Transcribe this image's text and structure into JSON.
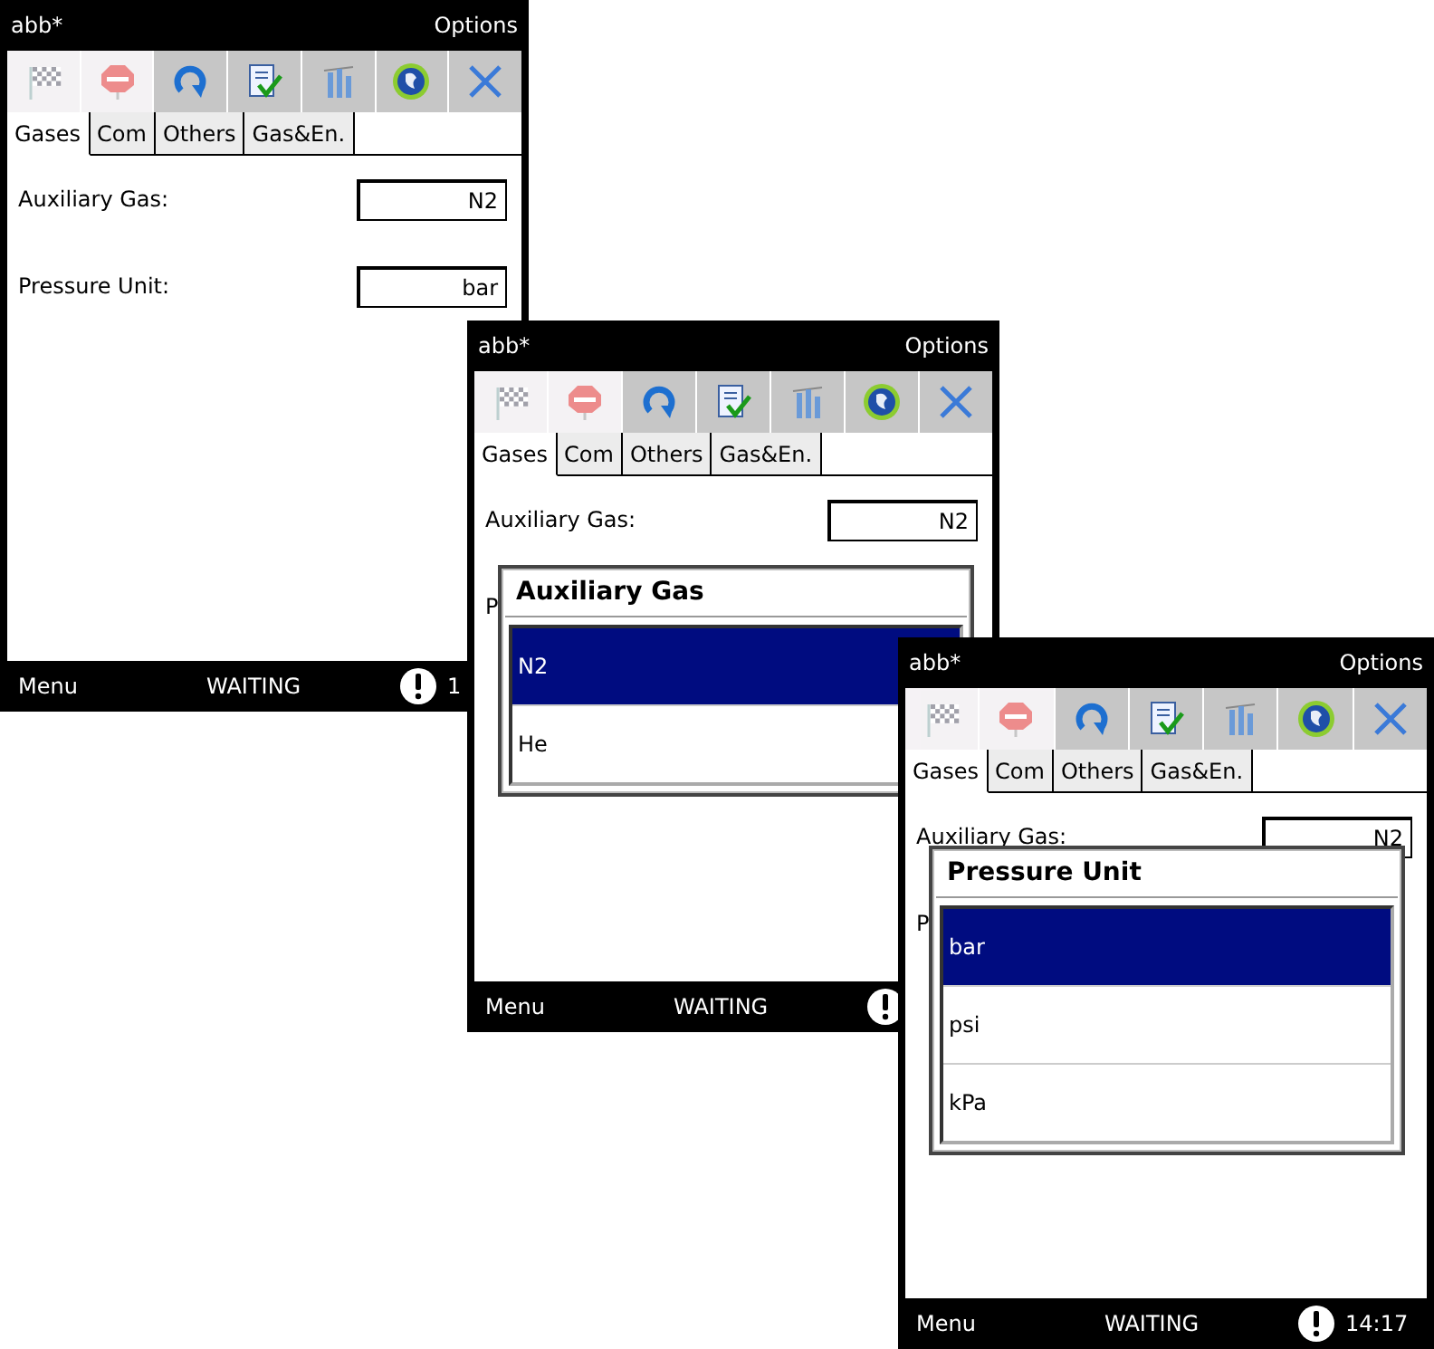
{
  "screens": [
    {
      "title": "abb*",
      "menu_right": "Options",
      "toolbar": [
        {
          "disabled": true
        },
        {
          "disabled": true
        },
        {
          "disabled": false
        },
        {
          "disabled": false
        },
        {
          "disabled": false
        },
        {
          "disabled": false
        },
        {
          "disabled": false
        }
      ],
      "tabs": [
        {
          "label": "Gases",
          "selected": true
        },
        {
          "label": "Com",
          "selected": false
        },
        {
          "label": "Others",
          "selected": false
        },
        {
          "label": "Gas&En.",
          "selected": false
        }
      ],
      "fields": [
        {
          "label": "Auxiliary Gas:",
          "value": "N2"
        },
        {
          "label": "Pressure Unit:",
          "value": "bar"
        }
      ],
      "status": {
        "left": "Menu",
        "center": "WAITING",
        "clock": "1"
      }
    },
    {
      "title": "abb*",
      "menu_right": "Options",
      "toolbar": [
        {
          "disabled": true
        },
        {
          "disabled": true
        },
        {
          "disabled": false
        },
        {
          "disabled": false
        },
        {
          "disabled": false
        },
        {
          "disabled": false
        },
        {
          "disabled": false
        }
      ],
      "tabs": [
        {
          "label": "Gases",
          "selected": true
        },
        {
          "label": "Com",
          "selected": false
        },
        {
          "label": "Others",
          "selected": false
        },
        {
          "label": "Gas&En.",
          "selected": false
        }
      ],
      "fields": [
        {
          "label": "Auxiliary Gas:",
          "value": "N2"
        },
        {
          "label": "P"
        }
      ],
      "popup": {
        "title": "Auxiliary Gas",
        "options": [
          {
            "label": "N2",
            "selected": true
          },
          {
            "label": "He",
            "selected": false
          }
        ]
      },
      "status": {
        "left": "Menu",
        "center": "WAITING"
      }
    },
    {
      "title": "abb*",
      "menu_right": "Options",
      "toolbar": [
        {
          "disabled": true
        },
        {
          "disabled": true
        },
        {
          "disabled": false
        },
        {
          "disabled": false
        },
        {
          "disabled": false
        },
        {
          "disabled": false
        },
        {
          "disabled": false
        }
      ],
      "tabs": [
        {
          "label": "Gases",
          "selected": true
        },
        {
          "label": "Com",
          "selected": false
        },
        {
          "label": "Others",
          "selected": false
        },
        {
          "label": "Gas&En.",
          "selected": false
        }
      ],
      "fields": [
        {
          "label": "Auxiliary Gas:",
          "value": "N2"
        },
        {
          "label": "P"
        }
      ],
      "popup": {
        "title": "Pressure Unit",
        "options": [
          {
            "label": "bar",
            "selected": true
          },
          {
            "label": "psi",
            "selected": false
          },
          {
            "label": "kPa",
            "selected": false
          }
        ]
      },
      "status": {
        "left": "Menu",
        "center": "WAITING",
        "clock": "14:17"
      }
    }
  ]
}
